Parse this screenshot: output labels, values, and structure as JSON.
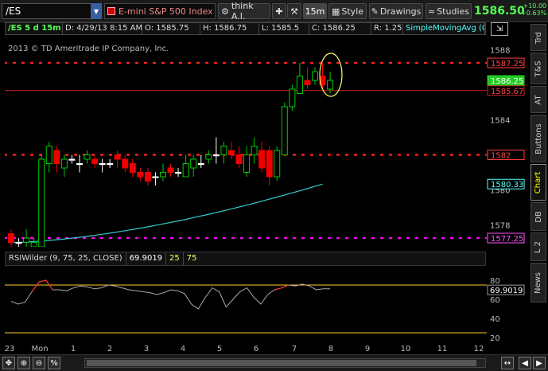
{
  "toolbar": {
    "symbol": "/ES",
    "description": "E-mini S&P 500 Index Fu...",
    "think_label": "think A.I.",
    "timeframe": "15m",
    "style_label": "Style",
    "drawings_label": "Drawings",
    "studies_label": "Studies",
    "last_price": "1586.50",
    "change_abs": "+10.00",
    "change_pct": "+0.63%"
  },
  "infobar": {
    "symbol_period": "/ES 5 d 15m",
    "date": "D: 4/29/13 8:15 AM",
    "open": "O: 1585.75",
    "high": "H: 1586.75",
    "low": "L: 1585.5",
    "close": "C: 1586.25",
    "range": "R: 1.25",
    "study": "SimpleMovingAvg (CLOSE, 50..."
  },
  "watermark": "2013 © TD Ameritrade IP Company, Inc.",
  "side_tabs": [
    "Trd",
    "T&S",
    "AT",
    "Buttons",
    "Chart",
    "DB",
    "L 2",
    "News"
  ],
  "active_tab": "Chart",
  "price_axis": {
    "ticks": [
      "1588",
      "1586",
      "1584",
      "1582",
      "1580",
      "1578"
    ],
    "price_tags": [
      {
        "label": "1587.25",
        "kind": "level",
        "value": 1587.25
      },
      {
        "label": "1586.25",
        "kind": "last",
        "value": 1586.25
      },
      {
        "label": "1585.67",
        "kind": "line",
        "value": 1585.67
      },
      {
        "label": "1582",
        "kind": "level",
        "value": 1582
      },
      {
        "label": "1580.33",
        "kind": "sma",
        "value": 1580.33
      },
      {
        "label": "1577.25",
        "kind": "support",
        "value": 1577.25
      }
    ]
  },
  "rsi": {
    "label": "RSIWilder (9, 75, 25, CLOSE)",
    "value": "69.9019",
    "oversold": "25",
    "overbought": "75",
    "ticks": [
      "80",
      "60",
      "40",
      "20"
    ],
    "current_tag": "69.9019"
  },
  "x_axis": {
    "labels": [
      "23",
      "Mon",
      "1",
      "2",
      "3",
      "4",
      "5",
      "6",
      "7",
      "8",
      "9",
      "10",
      "11",
      "12"
    ]
  },
  "colors": {
    "up": "#00cc00",
    "down": "#ee0000",
    "doji": "#ffffff",
    "sma": "#33cccc",
    "level_dots": "#ff2020",
    "support_dots": "#ff00ff",
    "last_price": "#33ff33"
  },
  "chart_data": {
    "type": "candlestick",
    "candles": [
      [
        1577.5,
        1577.75,
        1576.75,
        1577.0
      ],
      [
        1577.0,
        1577.25,
        1576.75,
        1577.0
      ],
      [
        1577.0,
        1577.75,
        1576.75,
        1577.25
      ],
      [
        1576.75,
        1577.25,
        1576.5,
        1577.0
      ],
      [
        1576.75,
        1582.0,
        1576.75,
        1581.75
      ],
      [
        1581.5,
        1582.75,
        1581.0,
        1582.5
      ],
      [
        1582.25,
        1582.5,
        1581.0,
        1581.5
      ],
      [
        1581.25,
        1582.0,
        1580.75,
        1581.75
      ],
      [
        1581.75,
        1582.0,
        1581.5,
        1581.75
      ],
      [
        1581.5,
        1582.0,
        1581.0,
        1581.5
      ],
      [
        1581.75,
        1582.25,
        1581.5,
        1582.0
      ],
      [
        1581.75,
        1582.0,
        1581.25,
        1581.5
      ],
      [
        1581.5,
        1581.75,
        1581.0,
        1581.5
      ],
      [
        1581.5,
        1581.75,
        1581.25,
        1581.5
      ],
      [
        1582.0,
        1582.25,
        1581.25,
        1581.75
      ],
      [
        1581.75,
        1582.0,
        1581.0,
        1581.25
      ],
      [
        1581.5,
        1581.75,
        1580.75,
        1581.0
      ],
      [
        1581.0,
        1581.25,
        1580.5,
        1580.75
      ],
      [
        1581.0,
        1581.25,
        1580.25,
        1580.5
      ],
      [
        1580.75,
        1581.0,
        1580.25,
        1580.75
      ],
      [
        1580.75,
        1581.5,
        1580.5,
        1581.0
      ],
      [
        1581.25,
        1581.5,
        1580.75,
        1581.0
      ],
      [
        1581.0,
        1581.25,
        1580.75,
        1581.0
      ],
      [
        1580.75,
        1582.0,
        1580.75,
        1581.5
      ],
      [
        1581.25,
        1582.0,
        1580.75,
        1581.75
      ],
      [
        1581.5,
        1582.0,
        1581.25,
        1581.5
      ],
      [
        1581.75,
        1582.25,
        1581.5,
        1582.0
      ],
      [
        1582.0,
        1583.0,
        1581.5,
        1582.0
      ],
      [
        1582.0,
        1582.75,
        1581.5,
        1582.5
      ],
      [
        1582.25,
        1582.75,
        1581.75,
        1582.0
      ],
      [
        1582.0,
        1582.5,
        1581.25,
        1581.5
      ],
      [
        1581.0,
        1582.5,
        1580.75,
        1582.0
      ],
      [
        1582.0,
        1583.0,
        1581.5,
        1582.5
      ],
      [
        1582.25,
        1582.75,
        1581.0,
        1581.25
      ],
      [
        1582.25,
        1582.5,
        1580.25,
        1580.75
      ],
      [
        1580.75,
        1582.5,
        1580.5,
        1582.25
      ],
      [
        1582.0,
        1585.0,
        1582.0,
        1584.75
      ],
      [
        1584.75,
        1586.0,
        1584.5,
        1585.75
      ],
      [
        1585.5,
        1587.25,
        1585.5,
        1586.5
      ],
      [
        1586.25,
        1587.0,
        1585.75,
        1586.0
      ],
      [
        1586.25,
        1587.0,
        1586.0,
        1586.75
      ],
      [
        1586.5,
        1587.25,
        1585.75,
        1586.0
      ],
      [
        1585.75,
        1586.75,
        1585.5,
        1586.25
      ]
    ],
    "sma_start": 1577.0,
    "sma_end": 1580.33,
    "levels": [
      1587.25,
      1582,
      1577.25
    ],
    "current_line": 1585.67,
    "y_range": [
      1576.75,
      1588.75
    ],
    "rsi_values": [
      58,
      55,
      57,
      68,
      78,
      80,
      70,
      70,
      69,
      72,
      74,
      73,
      71,
      72,
      75,
      74,
      72,
      70,
      69,
      68,
      67,
      65,
      67,
      70,
      69,
      66,
      55,
      50,
      62,
      72,
      68,
      52,
      60,
      68,
      72,
      62,
      55,
      65,
      70,
      72,
      75,
      74,
      76,
      74,
      70,
      71,
      71
    ]
  }
}
